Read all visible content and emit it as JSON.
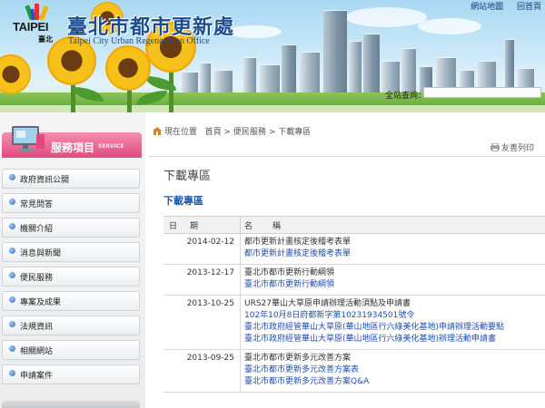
{
  "header": {
    "logo_text": "TAIPEI",
    "logo_sub": "臺北",
    "site_title": "臺北市都市更新處",
    "site_subtitle": "Taipei City Urban Regeneration Office",
    "top_links": [
      "網站地圖",
      "回首頁"
    ],
    "search_label": "全站查詢："
  },
  "sidebar": {
    "title": "服務項目",
    "title_en": "SERVICE",
    "items": [
      {
        "label": "政府資訊公開"
      },
      {
        "label": "常見問答"
      },
      {
        "label": "機關介紹"
      },
      {
        "label": "消息與新聞"
      },
      {
        "label": "便民服務"
      },
      {
        "label": "專案及成果"
      },
      {
        "label": "法規資訊"
      },
      {
        "label": "相關網站"
      },
      {
        "label": "申請案件"
      }
    ]
  },
  "breadcrumb": {
    "items": [
      "現在位置",
      "首頁",
      "便民服務",
      "下載專區"
    ],
    "separator": ">"
  },
  "print_label": "友善列印",
  "page": {
    "heading": "下載專區",
    "section_title": "下載專區"
  },
  "table": {
    "headers": [
      "日期",
      "名稱"
    ],
    "rows": [
      {
        "date": "2014-02-12",
        "title": "都市更新計畫核定後稽考表單",
        "links": [
          "都市更新計畫核定後稽考表單"
        ]
      },
      {
        "date": "2013-12-17",
        "title": "臺北市都市更新行動綱領",
        "links": [
          "臺北市都市更新行動綱領"
        ]
      },
      {
        "date": "2013-10-25",
        "title": "URS27華山大草原申請辦理活動須點及申請書",
        "links": [
          "102年10月8日府都新字第10231934501號令",
          "臺北市政府經管華山大草原(華山地區行六綠美化基地)申請辦理活動要點",
          "臺北市政府經管華山大草原(華山地區行六綠美化基地)辦理活動申請書"
        ]
      },
      {
        "date": "2013-09-25",
        "title": "臺北市都市更新多元改善方案",
        "links": [
          "臺北市都市更新多元改善方案表",
          "臺北市都市更新多元改善方案Q&A"
        ]
      }
    ]
  },
  "colors": {
    "title_blue": "#1d4d8e",
    "link_blue": "#1f4fb0",
    "sidebar_pink": "#e04a7f"
  }
}
